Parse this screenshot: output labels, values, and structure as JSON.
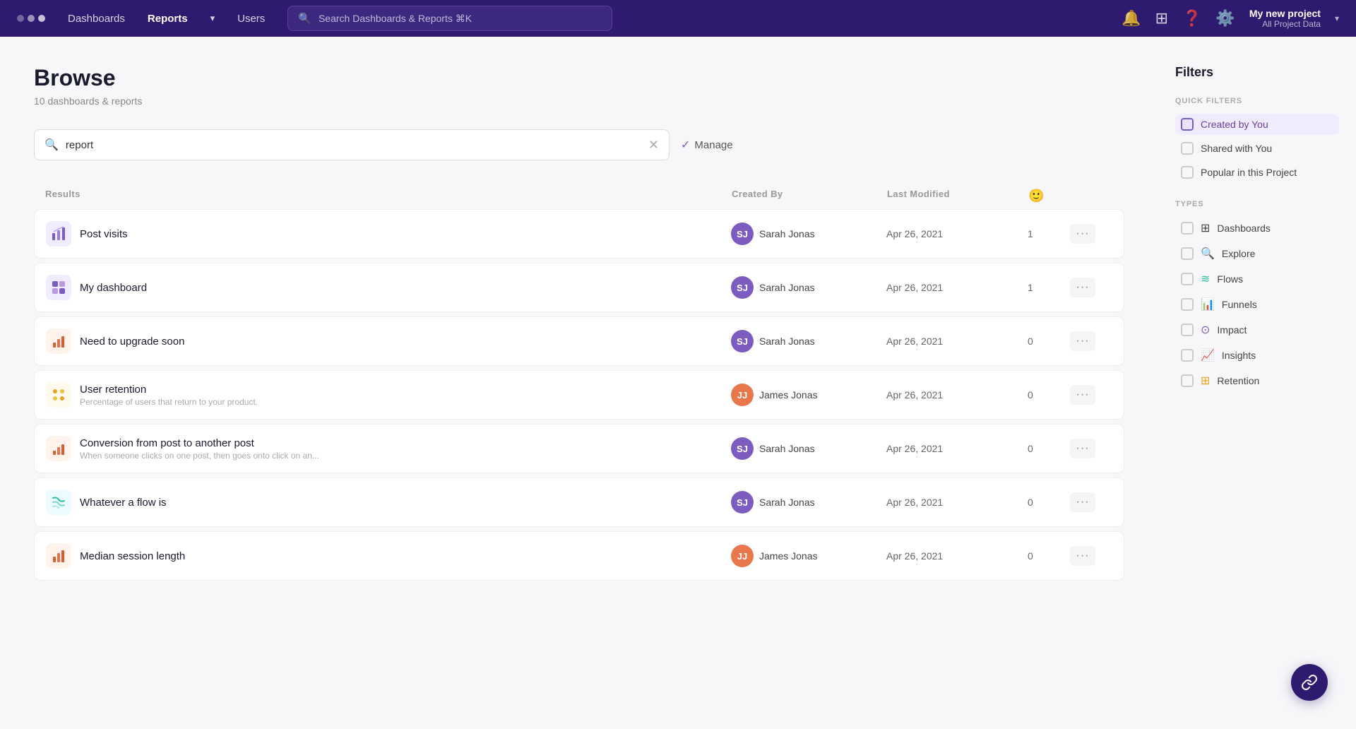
{
  "nav": {
    "dots": [
      "dot1",
      "dot2",
      "dot3"
    ],
    "links": [
      {
        "label": "Dashboards",
        "active": false
      },
      {
        "label": "Reports",
        "active": false
      },
      {
        "label": "Users",
        "active": false
      }
    ],
    "search_placeholder": "Search Dashboards & Reports ⌘K",
    "project_name": "My new project",
    "project_sub": "All Project Data"
  },
  "page": {
    "title": "Browse",
    "subtitle": "10 dashboards & reports",
    "search_value": "report",
    "manage_label": "Manage"
  },
  "table": {
    "headers": [
      "Results",
      "Created By",
      "Last Modified",
      "",
      ""
    ],
    "rows": [
      {
        "name": "Post visits",
        "sub": "",
        "icon_type": "funnel",
        "icon_color": "purple-light",
        "creator": "Sarah Jonas",
        "creator_initials": "SJ",
        "creator_color": "purple",
        "date": "Apr 26, 2021",
        "count": "1"
      },
      {
        "name": "My dashboard",
        "sub": "",
        "icon_type": "dashboard",
        "icon_color": "purple-light",
        "creator": "Sarah Jonas",
        "creator_initials": "SJ",
        "creator_color": "purple",
        "date": "Apr 26, 2021",
        "count": "1"
      },
      {
        "name": "Need to upgrade soon",
        "sub": "",
        "icon_type": "funnel-red",
        "icon_color": "orange",
        "creator": "Sarah Jonas",
        "creator_initials": "SJ",
        "creator_color": "purple",
        "date": "Apr 26, 2021",
        "count": "0"
      },
      {
        "name": "User retention",
        "sub": "Percentage of users that return to your product.",
        "icon_type": "retention",
        "icon_color": "yellow",
        "creator": "James Jonas",
        "creator_initials": "JJ",
        "creator_color": "orange",
        "date": "Apr 26, 2021",
        "count": "0"
      },
      {
        "name": "Conversion from post to another post",
        "sub": "When someone clicks on one post, then goes onto click on an...",
        "icon_type": "funnel-red2",
        "icon_color": "orange",
        "creator": "Sarah Jonas",
        "creator_initials": "SJ",
        "creator_color": "purple",
        "date": "Apr 26, 2021",
        "count": "0"
      },
      {
        "name": "Whatever a flow is",
        "sub": "",
        "icon_type": "flow",
        "icon_color": "teal",
        "creator": "Sarah Jonas",
        "creator_initials": "SJ",
        "creator_color": "purple",
        "date": "Apr 26, 2021",
        "count": "0"
      },
      {
        "name": "Median session length",
        "sub": "",
        "icon_type": "funnel-red3",
        "icon_color": "orange",
        "creator": "James Jonas",
        "creator_initials": "JJ",
        "creator_color": "orange",
        "date": "Apr 26, 2021",
        "count": "0"
      }
    ]
  },
  "filters": {
    "title": "Filters",
    "quick_filters_label": "QUICK FILTERS",
    "quick_filters": [
      {
        "label": "Created by You",
        "active": true
      },
      {
        "label": "Shared with You",
        "active": false
      },
      {
        "label": "Popular in this Project",
        "active": false
      }
    ],
    "types_label": "TYPES",
    "types": [
      {
        "label": "Dashboards",
        "icon": "dashboard"
      },
      {
        "label": "Explore",
        "icon": "explore"
      },
      {
        "label": "Flows",
        "icon": "flows"
      },
      {
        "label": "Funnels",
        "icon": "funnels"
      },
      {
        "label": "Impact",
        "icon": "impact"
      },
      {
        "label": "Insights",
        "icon": "insights"
      },
      {
        "label": "Retention",
        "icon": "retention"
      }
    ]
  },
  "fab": {
    "icon": "link-icon"
  }
}
